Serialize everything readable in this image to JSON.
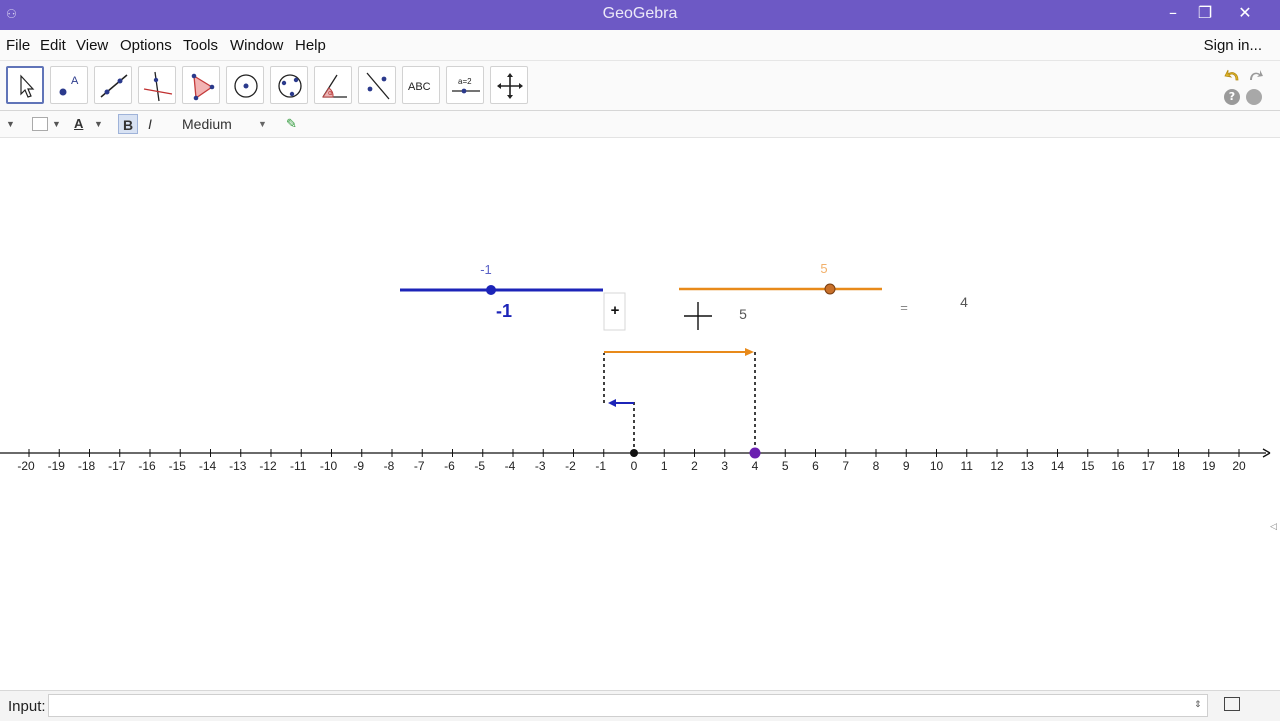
{
  "window": {
    "title": "GeoGebra"
  },
  "menu": {
    "items": [
      {
        "id": "file",
        "label": "File"
      },
      {
        "id": "edit",
        "label": "Edit"
      },
      {
        "id": "view",
        "label": "View"
      },
      {
        "id": "options",
        "label": "Options"
      },
      {
        "id": "tools",
        "label": "Tools"
      },
      {
        "id": "window",
        "label": "Window"
      },
      {
        "id": "help",
        "label": "Help"
      }
    ],
    "sign_in": "Sign in..."
  },
  "toolbar": {
    "tools": [
      {
        "name": "move-tool-icon",
        "selected": true
      },
      {
        "name": "point-tool-icon"
      },
      {
        "name": "line-tool-icon"
      },
      {
        "name": "perpendicular-line-tool-icon"
      },
      {
        "name": "polygon-tool-icon"
      },
      {
        "name": "circle-tool-icon"
      },
      {
        "name": "ellipse-tool-icon"
      },
      {
        "name": "angle-tool-icon"
      },
      {
        "name": "reflect-tool-icon"
      },
      {
        "name": "text-tool-icon",
        "text": "ABC"
      },
      {
        "name": "slider-tool-icon",
        "text": "a=2"
      },
      {
        "name": "move-graphics-view-tool-icon"
      }
    ]
  },
  "stylebar": {
    "bold": "B",
    "italic": "I",
    "text_size": "Medium"
  },
  "graphics": {
    "slider_a": {
      "label": "-1",
      "value": -1,
      "value_text": "-1",
      "color": "#1c24b8"
    },
    "slider_b": {
      "label": "5",
      "value": 5,
      "value_text": "5",
      "color": "#e88a1a"
    },
    "plus_sign": "+",
    "equals_sign": "=",
    "result": "4",
    "number_line": {
      "ticks": [
        "-20",
        "-19",
        "-18",
        "-17",
        "-16",
        "-15",
        "-14",
        "-13",
        "-12",
        "-11",
        "-10",
        "-9",
        "-8",
        "-7",
        "-6",
        "-5",
        "-4",
        "-3",
        "-2",
        "-1",
        "0",
        "1",
        "2",
        "3",
        "4",
        "5",
        "6",
        "7",
        "8",
        "9",
        "10",
        "11",
        "12",
        "13",
        "14",
        "15",
        "16",
        "17",
        "18",
        "19",
        "20"
      ]
    },
    "points": [
      {
        "name": "origin-point",
        "value": 0,
        "color": "#111111"
      },
      {
        "name": "sum-point",
        "value": 4,
        "color": "#6a1fb0"
      }
    ]
  },
  "input_bar": {
    "label": "Input:"
  }
}
